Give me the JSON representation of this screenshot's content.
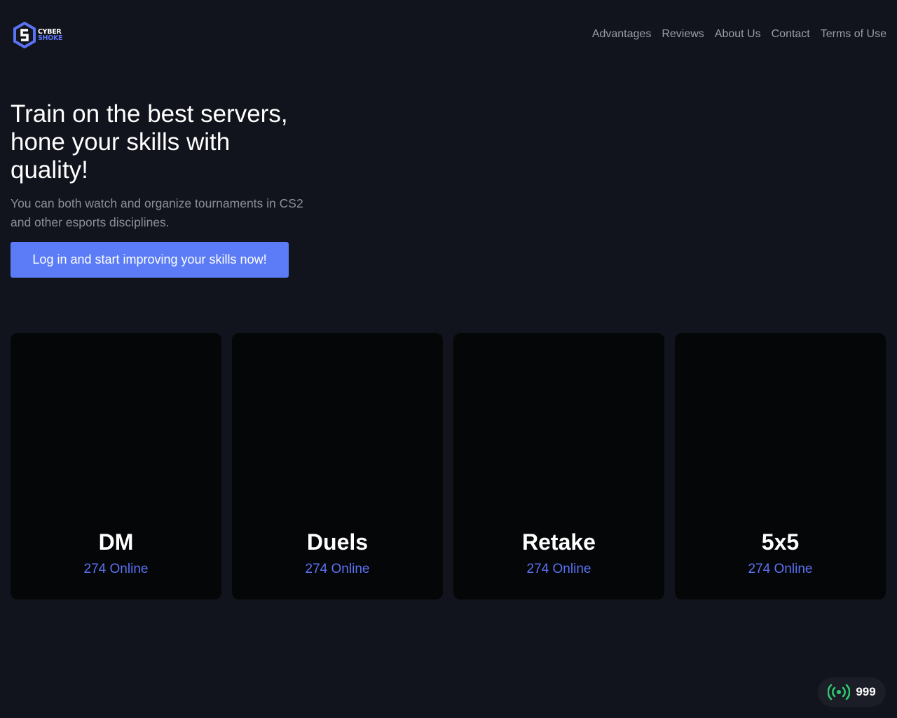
{
  "logo": {
    "line1": "CYBER",
    "line2": "SHOKE"
  },
  "nav": [
    "Advantages",
    "Reviews",
    "About Us",
    "Contact",
    "Terms of Use"
  ],
  "hero": {
    "title": "Train on the best servers, hone your skills with quality!",
    "subtitle": "You can both watch and organize tournaments in CS2 and other esports disciplines.",
    "cta": "Log in and start improving your skills now!"
  },
  "modes": [
    {
      "name": "DM",
      "online": "274 Online"
    },
    {
      "name": "Duels",
      "online": "274 Online"
    },
    {
      "name": "Retake",
      "online": "274 Online"
    },
    {
      "name": "5x5",
      "online": "274 Online"
    }
  ],
  "status": {
    "icon": "broadcast-icon",
    "count": "999",
    "color": "#2ecc71"
  },
  "colors": {
    "accent": "#5b7cf6",
    "bg": "#11141c"
  }
}
